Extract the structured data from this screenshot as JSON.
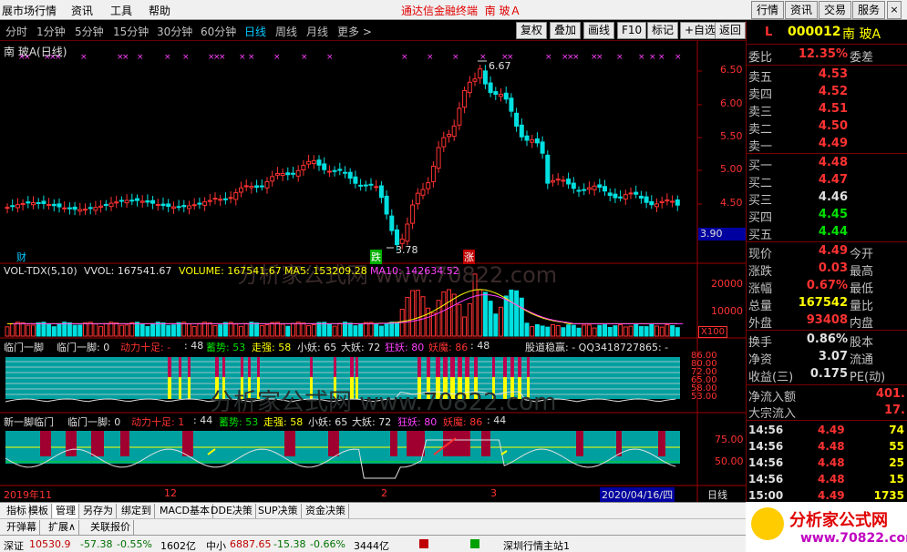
{
  "menu": {
    "items": [
      "展市场行情",
      "资讯",
      "工具",
      "帮助"
    ],
    "title": "通达信金融终端",
    "stock_title": "南 玻Ａ",
    "right_buttons": [
      "行情",
      "资讯",
      "交易",
      "服务"
    ]
  },
  "toolbar": {
    "timeframes": [
      "分时",
      "1分钟",
      "5分钟",
      "15分钟",
      "30分钟",
      "60分钟",
      "日线",
      "周线",
      "月线",
      "更多 >"
    ],
    "active_timeframe": "日线",
    "buttons": [
      "复权",
      "叠加",
      "画线",
      "F10",
      "标记",
      "+自选",
      "返回"
    ]
  },
  "main_chart": {
    "title": "南 玻A(日线)",
    "high_label": "6.67",
    "low_label": "3.78",
    "price_tag": "3.90",
    "badge_cai": "财",
    "badge_die": "跌",
    "badge_zhang": "涨",
    "y_ticks": [
      "6.50",
      "6.00",
      "5.50",
      "5.00",
      "4.50"
    ]
  },
  "vol_chart": {
    "label": "VOL-TDX(5,10)",
    "vvol": "VVOL: 167541.67",
    "volume": "VOLUME: 167541.67",
    "ma5": "MA5: 153209.28",
    "ma10": "MA10: 142634.52",
    "y_ticks": [
      "20000",
      "10000"
    ],
    "unit": "X100"
  },
  "ind1": {
    "name": "临门一脚",
    "f1": "临门一脚: 0",
    "f2": "动力十足: -",
    "f2b": ": 48",
    "f3": "蓄势: 53",
    "f4": "走强: 58",
    "f5": "小妖: 65",
    "f6": "大妖: 72",
    "f7": "狂妖: 80",
    "f8": "妖魔: 86",
    "f9": ": 48",
    "extra": "股道稳赢: - QQ3418727865: -",
    "y_ticks": [
      "86.00",
      "80.00",
      "72.00",
      "65.00",
      "58.00",
      "53.00"
    ]
  },
  "ind2": {
    "name": "新一脚临门",
    "f1": "临门一脚: 0",
    "f2": "动力十足: 1",
    "f2b": ": 44",
    "f3": "蓄势: 53",
    "f4": "走强: 58",
    "f5": "小妖: 65",
    "f6": "大妖: 72",
    "f7": "狂妖: 80",
    "f8": "妖魔: 86",
    "f9": ": 44",
    "y_ticks": [
      "75.00",
      "50.00"
    ]
  },
  "xaxis": {
    "labels": [
      "2019年11",
      "12",
      "2",
      "3"
    ],
    "date": "2020/04/16/四",
    "period": "日线"
  },
  "watermark": "分析家公式网 www.70822.com",
  "quote": {
    "L": "L",
    "code": "000012",
    "name": "南 玻A",
    "weibi_label": "委比",
    "weibi": "12.35%",
    "weicha_label": "委差",
    "sell": [
      {
        "label": "卖五",
        "price": "4.53"
      },
      {
        "label": "卖四",
        "price": "4.52"
      },
      {
        "label": "卖三",
        "price": "4.51"
      },
      {
        "label": "卖二",
        "price": "4.50"
      },
      {
        "label": "卖一",
        "price": "4.49"
      }
    ],
    "buy": [
      {
        "label": "买一",
        "price": "4.48"
      },
      {
        "label": "买二",
        "price": "4.47"
      },
      {
        "label": "买三",
        "price": "4.46"
      },
      {
        "label": "买四",
        "price": "4.45"
      },
      {
        "label": "买五",
        "price": "4.44"
      }
    ],
    "stats": [
      {
        "l1": "现价",
        "v1": "4.49",
        "l2": "今开"
      },
      {
        "l1": "涨跌",
        "v1": "0.03",
        "l2": "最高"
      },
      {
        "l1": "涨幅",
        "v1": "0.67%",
        "l2": "最低"
      },
      {
        "l1": "总量",
        "v1": "167542",
        "l2": "量比"
      },
      {
        "l1": "外盘",
        "v1": "93408",
        "l2": "内盘"
      }
    ],
    "stats2": [
      {
        "l1": "换手",
        "v1": "0.86%",
        "l2": "股本"
      },
      {
        "l1": "净资",
        "v1": "3.07",
        "l2": "流通"
      },
      {
        "l1": "收益(三)",
        "v1": "0.175",
        "l2": "PE(动)"
      }
    ],
    "flow": [
      {
        "l": "净流入额",
        "v": "401."
      },
      {
        "l": "大宗流入",
        "v": "17."
      }
    ],
    "ticks": [
      {
        "t": "14:56",
        "p": "4.49",
        "v": "74"
      },
      {
        "t": "14:56",
        "p": "4.48",
        "v": "55"
      },
      {
        "t": "14:56",
        "p": "4.48",
        "v": "25"
      },
      {
        "t": "14:56",
        "p": "4.48",
        "v": "15"
      },
      {
        "t": "15:00",
        "p": "4.49",
        "v": "1735"
      }
    ]
  },
  "tabs": [
    "指标",
    "模板",
    "管理",
    "另存为",
    "绑定到",
    "MACD基本",
    "DDE决策",
    "SUP决策",
    "资金决策"
  ],
  "active_tab": "管理",
  "tabs2": [
    "开弹幕",
    "扩展∧",
    "关联报价"
  ],
  "status": {
    "s1": "深证",
    "s1v": "10530.9",
    "s1c": "-57.38",
    "s1p": "-0.55%",
    "s1a": "1602亿",
    "s2": "中小",
    "s2v": "6887.65",
    "s2c": "-15.38",
    "s2p": "-0.66%",
    "s2a": "3444亿",
    "s3": "深圳行情主站1"
  },
  "logo": {
    "text": "分析家公式网",
    "url": "www.70822.com"
  }
}
